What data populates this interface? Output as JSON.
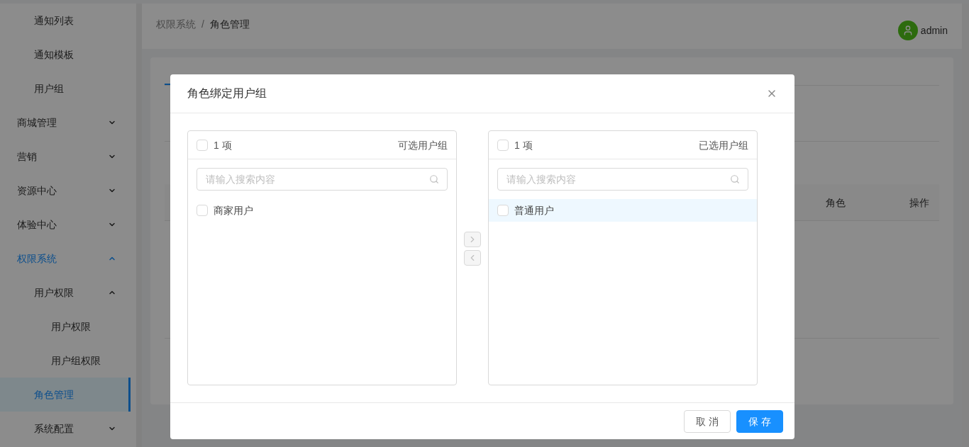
{
  "sidebar": {
    "items": [
      {
        "children": [
          {
            "label": "通知列表",
            "selected": false
          },
          {
            "label": "通知模板",
            "selected": false
          },
          {
            "label": "用户组",
            "selected": false
          }
        ]
      },
      {
        "label": "商城管理",
        "expanded": false,
        "selected": false
      },
      {
        "label": "营销",
        "expanded": false,
        "selected": false
      },
      {
        "label": "资源中心",
        "expanded": false,
        "selected": false
      },
      {
        "label": "体验中心",
        "expanded": false,
        "selected": false
      },
      {
        "label": "权限系统",
        "expanded": true,
        "selected": false,
        "children": [
          {
            "label": "用户权限",
            "expanded": true,
            "selected": false,
            "children": [
              {
                "label": "用户权限",
                "selected": false
              },
              {
                "label": "用户组权限",
                "selected": false
              }
            ]
          },
          {
            "label": "角色管理",
            "selected": true
          },
          {
            "label": "系统配置",
            "expanded": false,
            "selected": false
          }
        ]
      }
    ]
  },
  "header": {
    "breadcrumb": {
      "parent": "权限系统",
      "separator": "/",
      "current": "角色管理"
    },
    "user": "admin"
  },
  "table": {
    "columns": [
      "角色",
      "操作"
    ]
  },
  "dialog": {
    "title": "角色绑定用户组",
    "transfer": {
      "panels": [
        {
          "count": "1 项",
          "title": "可选用户组",
          "checked": false,
          "placeholder": "请输入搜索内容",
          "items": [
            {
              "label": "商家用户",
              "checked": false,
              "hovered": false
            }
          ]
        },
        {
          "count": "1 项",
          "title": "已选用户组",
          "checked": false,
          "placeholder": "请输入搜索内容",
          "items": [
            {
              "label": "普通用户",
              "checked": false,
              "hovered": true
            }
          ]
        }
      ],
      "move_right_disabled": true,
      "move_left_disabled": true
    },
    "buttons": [
      {
        "label": "取 消",
        "kind": "default"
      },
      {
        "label": "保 存",
        "kind": "primary"
      }
    ]
  }
}
